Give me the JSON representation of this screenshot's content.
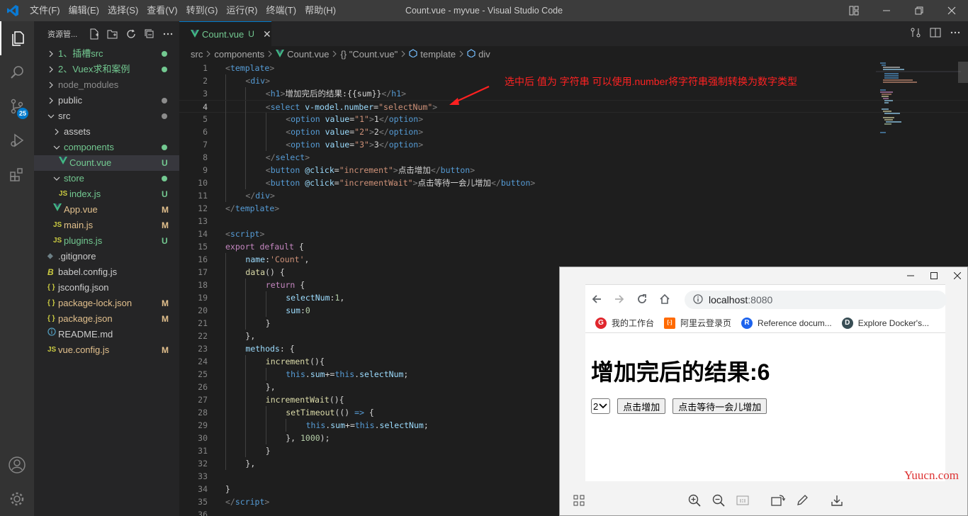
{
  "window": {
    "title": "Count.vue - myvue - Visual Studio Code"
  },
  "menu": [
    "文件(F)",
    "编辑(E)",
    "选择(S)",
    "查看(V)",
    "转到(G)",
    "运行(R)",
    "终端(T)",
    "帮助(H)"
  ],
  "activity": {
    "scm_badge": "25"
  },
  "explorer": {
    "title": "资源管...",
    "items": [
      {
        "label": "1、插槽src",
        "indent": 0,
        "chevron": ">",
        "icon": "",
        "color": "#73c991",
        "marker": "dot",
        "marker_color": "#73c991"
      },
      {
        "label": "2、Vuex求和案例",
        "indent": 0,
        "chevron": ">",
        "icon": "",
        "color": "#73c991",
        "marker": "dot",
        "marker_color": "#73c991"
      },
      {
        "label": "node_modules",
        "indent": 0,
        "chevron": ">",
        "icon": "",
        "color": "#8c8c8c",
        "marker": "",
        "marker_color": ""
      },
      {
        "label": "public",
        "indent": 0,
        "chevron": ">",
        "icon": "",
        "color": "#cccccc",
        "marker": "dot",
        "marker_color": "#8c8c8c"
      },
      {
        "label": "src",
        "indent": 0,
        "chevron": "v",
        "icon": "",
        "color": "#cccccc",
        "marker": "dot",
        "marker_color": "#8c8c8c"
      },
      {
        "label": "assets",
        "indent": 1,
        "chevron": ">",
        "icon": "",
        "color": "#cccccc",
        "marker": "",
        "marker_color": ""
      },
      {
        "label": "components",
        "indent": 1,
        "chevron": "v",
        "icon": "",
        "color": "#73c991",
        "marker": "dot",
        "marker_color": "#73c991"
      },
      {
        "label": "Count.vue",
        "indent": 2,
        "chevron": "",
        "icon": "vue",
        "color": "#73c991",
        "marker": "U",
        "marker_color": "#73c991",
        "active": true
      },
      {
        "label": "store",
        "indent": 1,
        "chevron": "v",
        "icon": "",
        "color": "#73c991",
        "marker": "dot",
        "marker_color": "#73c991"
      },
      {
        "label": "index.js",
        "indent": 2,
        "chevron": "",
        "icon": "js",
        "color": "#73c991",
        "marker": "U",
        "marker_color": "#73c991"
      },
      {
        "label": "App.vue",
        "indent": 1,
        "chevron": "",
        "icon": "vue",
        "color": "#e2c08d",
        "marker": "M",
        "marker_color": "#e2c08d"
      },
      {
        "label": "main.js",
        "indent": 1,
        "chevron": "",
        "icon": "js",
        "color": "#e2c08d",
        "marker": "M",
        "marker_color": "#e2c08d"
      },
      {
        "label": "plugins.js",
        "indent": 1,
        "chevron": "",
        "icon": "js",
        "color": "#73c991",
        "marker": "U",
        "marker_color": "#73c991"
      },
      {
        "label": ".gitignore",
        "indent": 0,
        "chevron": "",
        "icon": "git",
        "color": "#cccccc",
        "marker": "",
        "marker_color": ""
      },
      {
        "label": "babel.config.js",
        "indent": 0,
        "chevron": "",
        "icon": "babel",
        "color": "#cccccc",
        "marker": "",
        "marker_color": ""
      },
      {
        "label": "jsconfig.json",
        "indent": 0,
        "chevron": "",
        "icon": "json",
        "color": "#cccccc",
        "marker": "",
        "marker_color": ""
      },
      {
        "label": "package-lock.json",
        "indent": 0,
        "chevron": "",
        "icon": "json",
        "color": "#e2c08d",
        "marker": "M",
        "marker_color": "#e2c08d"
      },
      {
        "label": "package.json",
        "indent": 0,
        "chevron": "",
        "icon": "json",
        "color": "#e2c08d",
        "marker": "M",
        "marker_color": "#e2c08d"
      },
      {
        "label": "README.md",
        "indent": 0,
        "chevron": "",
        "icon": "info",
        "color": "#cccccc",
        "marker": "",
        "marker_color": ""
      },
      {
        "label": "vue.config.js",
        "indent": 0,
        "chevron": "",
        "icon": "js",
        "color": "#e2c08d",
        "marker": "M",
        "marker_color": "#e2c08d"
      }
    ]
  },
  "tab": {
    "label": "Count.vue",
    "status": "U"
  },
  "breadcrumb": [
    "src",
    "components",
    "Count.vue",
    "{} \"Count.vue\"",
    "template",
    "div"
  ],
  "annotation": "选中后 值为 字符串  可以使用.number将字符串强制转换为数字类型",
  "current_line": 4,
  "code_lines": [
    {
      "n": 1,
      "i": 0,
      "t": [
        [
          "t-bracket",
          "<"
        ],
        [
          "t-tag",
          "template"
        ],
        [
          "t-bracket",
          ">"
        ]
      ]
    },
    {
      "n": 2,
      "i": 1,
      "t": [
        [
          "t-bracket",
          "<"
        ],
        [
          "t-tag",
          "div"
        ],
        [
          "t-bracket",
          ">"
        ]
      ]
    },
    {
      "n": 3,
      "i": 2,
      "t": [
        [
          "t-bracket",
          "<"
        ],
        [
          "t-tag",
          "h1"
        ],
        [
          "t-bracket",
          ">"
        ],
        [
          "t-text",
          "增加完后的结果:{{sum}}"
        ],
        [
          "t-bracket",
          "</"
        ],
        [
          "t-tag",
          "h1"
        ],
        [
          "t-bracket",
          ">"
        ]
      ]
    },
    {
      "n": 4,
      "i": 2,
      "t": [
        [
          "t-bracket",
          "<"
        ],
        [
          "t-tag",
          "select"
        ],
        [
          "t-text",
          " "
        ],
        [
          "t-attr",
          "v-model.number"
        ],
        [
          "t-text",
          "="
        ],
        [
          "t-str",
          "\"selectNum\""
        ],
        [
          "t-bracket",
          ">"
        ]
      ]
    },
    {
      "n": 5,
      "i": 3,
      "t": [
        [
          "t-bracket",
          "<"
        ],
        [
          "t-tag",
          "option"
        ],
        [
          "t-text",
          " "
        ],
        [
          "t-attr",
          "value"
        ],
        [
          "t-text",
          "="
        ],
        [
          "t-str",
          "\"1\""
        ],
        [
          "t-bracket",
          ">"
        ],
        [
          "t-text",
          "1"
        ],
        [
          "t-bracket",
          "</"
        ],
        [
          "t-tag",
          "option"
        ],
        [
          "t-bracket",
          ">"
        ]
      ]
    },
    {
      "n": 6,
      "i": 3,
      "t": [
        [
          "t-bracket",
          "<"
        ],
        [
          "t-tag",
          "option"
        ],
        [
          "t-text",
          " "
        ],
        [
          "t-attr",
          "value"
        ],
        [
          "t-text",
          "="
        ],
        [
          "t-str",
          "\"2\""
        ],
        [
          "t-bracket",
          ">"
        ],
        [
          "t-text",
          "2"
        ],
        [
          "t-bracket",
          "</"
        ],
        [
          "t-tag",
          "option"
        ],
        [
          "t-bracket",
          ">"
        ]
      ]
    },
    {
      "n": 7,
      "i": 3,
      "t": [
        [
          "t-bracket",
          "<"
        ],
        [
          "t-tag",
          "option"
        ],
        [
          "t-text",
          " "
        ],
        [
          "t-attr",
          "value"
        ],
        [
          "t-text",
          "="
        ],
        [
          "t-str",
          "\"3\""
        ],
        [
          "t-bracket",
          ">"
        ],
        [
          "t-text",
          "3"
        ],
        [
          "t-bracket",
          "</"
        ],
        [
          "t-tag",
          "option"
        ],
        [
          "t-bracket",
          ">"
        ]
      ]
    },
    {
      "n": 8,
      "i": 2,
      "t": [
        [
          "t-bracket",
          "</"
        ],
        [
          "t-tag",
          "select"
        ],
        [
          "t-bracket",
          ">"
        ]
      ]
    },
    {
      "n": 9,
      "i": 2,
      "t": [
        [
          "t-bracket",
          "<"
        ],
        [
          "t-tag",
          "button"
        ],
        [
          "t-text",
          " "
        ],
        [
          "t-attr",
          "@click"
        ],
        [
          "t-text",
          "="
        ],
        [
          "t-str",
          "\"increment\""
        ],
        [
          "t-bracket",
          ">"
        ],
        [
          "t-text",
          "点击增加"
        ],
        [
          "t-bracket",
          "</"
        ],
        [
          "t-tag",
          "button"
        ],
        [
          "t-bracket",
          ">"
        ]
      ]
    },
    {
      "n": 10,
      "i": 2,
      "t": [
        [
          "t-bracket",
          "<"
        ],
        [
          "t-tag",
          "button"
        ],
        [
          "t-text",
          " "
        ],
        [
          "t-attr",
          "@click"
        ],
        [
          "t-text",
          "="
        ],
        [
          "t-str",
          "\"incrementWait\""
        ],
        [
          "t-bracket",
          ">"
        ],
        [
          "t-text",
          "点击等待一会儿增加"
        ],
        [
          "t-bracket",
          "</"
        ],
        [
          "t-tag",
          "button"
        ],
        [
          "t-bracket",
          ">"
        ]
      ]
    },
    {
      "n": 11,
      "i": 1,
      "t": [
        [
          "t-bracket",
          "</"
        ],
        [
          "t-tag",
          "div"
        ],
        [
          "t-bracket",
          ">"
        ]
      ]
    },
    {
      "n": 12,
      "i": 0,
      "t": [
        [
          "t-bracket",
          "</"
        ],
        [
          "t-tag",
          "template"
        ],
        [
          "t-bracket",
          ">"
        ]
      ]
    },
    {
      "n": 13,
      "i": 0,
      "t": []
    },
    {
      "n": 14,
      "i": 0,
      "t": [
        [
          "t-bracket",
          "<"
        ],
        [
          "t-tag",
          "script"
        ],
        [
          "t-bracket",
          ">"
        ]
      ]
    },
    {
      "n": 15,
      "i": 0,
      "t": [
        [
          "t-kw",
          "export"
        ],
        [
          "t-text",
          " "
        ],
        [
          "t-kw",
          "default"
        ],
        [
          "t-text",
          " {"
        ]
      ]
    },
    {
      "n": 16,
      "i": 1,
      "t": [
        [
          "t-prop",
          "name"
        ],
        [
          "t-text",
          ":"
        ],
        [
          "t-str",
          "'Count'"
        ],
        [
          "t-text",
          ","
        ]
      ]
    },
    {
      "n": 17,
      "i": 1,
      "t": [
        [
          "t-fn",
          "data"
        ],
        [
          "t-text",
          "() {"
        ]
      ]
    },
    {
      "n": 18,
      "i": 2,
      "t": [
        [
          "t-kw",
          "return"
        ],
        [
          "t-text",
          " {"
        ]
      ]
    },
    {
      "n": 19,
      "i": 3,
      "t": [
        [
          "t-prop",
          "selectNum"
        ],
        [
          "t-text",
          ":"
        ],
        [
          "t-num",
          "1"
        ],
        [
          "t-text",
          ","
        ]
      ]
    },
    {
      "n": 20,
      "i": 3,
      "t": [
        [
          "t-prop",
          "sum"
        ],
        [
          "t-text",
          ":"
        ],
        [
          "t-num",
          "0"
        ]
      ]
    },
    {
      "n": 21,
      "i": 2,
      "t": [
        [
          "t-text",
          "}"
        ]
      ]
    },
    {
      "n": 22,
      "i": 1,
      "t": [
        [
          "t-text",
          "},"
        ]
      ]
    },
    {
      "n": 23,
      "i": 1,
      "t": [
        [
          "t-prop",
          "methods"
        ],
        [
          "t-text",
          ": {"
        ]
      ]
    },
    {
      "n": 24,
      "i": 2,
      "t": [
        [
          "t-fn",
          "increment"
        ],
        [
          "t-text",
          "(){"
        ]
      ]
    },
    {
      "n": 25,
      "i": 3,
      "t": [
        [
          "t-this",
          "this"
        ],
        [
          "t-text",
          "."
        ],
        [
          "t-prop",
          "sum"
        ],
        [
          "t-text",
          "+="
        ],
        [
          "t-this",
          "this"
        ],
        [
          "t-text",
          "."
        ],
        [
          "t-prop",
          "selectNum"
        ],
        [
          "t-text",
          ";"
        ]
      ]
    },
    {
      "n": 26,
      "i": 2,
      "t": [
        [
          "t-text",
          "},"
        ]
      ]
    },
    {
      "n": 27,
      "i": 2,
      "t": [
        [
          "t-fn",
          "incrementWait"
        ],
        [
          "t-text",
          "(){"
        ]
      ]
    },
    {
      "n": 28,
      "i": 3,
      "t": [
        [
          "t-fn",
          "setTimeout"
        ],
        [
          "t-text",
          "(() "
        ],
        [
          "t-this",
          "=>"
        ],
        [
          "t-text",
          " {"
        ]
      ]
    },
    {
      "n": 29,
      "i": 4,
      "t": [
        [
          "t-this",
          "this"
        ],
        [
          "t-text",
          "."
        ],
        [
          "t-prop",
          "sum"
        ],
        [
          "t-text",
          "+="
        ],
        [
          "t-this",
          "this"
        ],
        [
          "t-text",
          "."
        ],
        [
          "t-prop",
          "selectNum"
        ],
        [
          "t-text",
          ";"
        ]
      ]
    },
    {
      "n": 30,
      "i": 3,
      "t": [
        [
          "t-text",
          "}, "
        ],
        [
          "t-num",
          "1000"
        ],
        [
          "t-text",
          ");"
        ]
      ]
    },
    {
      "n": 31,
      "i": 2,
      "t": [
        [
          "t-text",
          "}"
        ]
      ]
    },
    {
      "n": 32,
      "i": 1,
      "t": [
        [
          "t-text",
          "},"
        ]
      ]
    },
    {
      "n": 33,
      "i": 0,
      "t": []
    },
    {
      "n": 34,
      "i": 0,
      "t": [
        [
          "t-text",
          "}"
        ]
      ]
    },
    {
      "n": 35,
      "i": 0,
      "t": [
        [
          "t-bracket",
          "</"
        ],
        [
          "t-tag",
          "script"
        ],
        [
          "t-bracket",
          ">"
        ]
      ]
    },
    {
      "n": 36,
      "i": 0,
      "t": []
    }
  ],
  "browser": {
    "address_host": "localhost",
    "address_port": ":8080",
    "bookmarks": [
      {
        "label": "我的工作台",
        "icon_color": "#e0262d",
        "glyph": "G"
      },
      {
        "label": "阿里云登录页",
        "icon_color": "#ff6a00",
        "glyph": "[-]"
      },
      {
        "label": "Reference docum...",
        "icon_color": "#1d63ed",
        "glyph": "R"
      },
      {
        "label": "Explore Docker's...",
        "icon_color": "#384d54",
        "glyph": "D"
      }
    ],
    "heading": "增加完后的结果:6",
    "select_value": "2",
    "button1": "点击增加",
    "button2": "点击等待一会儿增加"
  },
  "watermark": "Yuucn.com"
}
